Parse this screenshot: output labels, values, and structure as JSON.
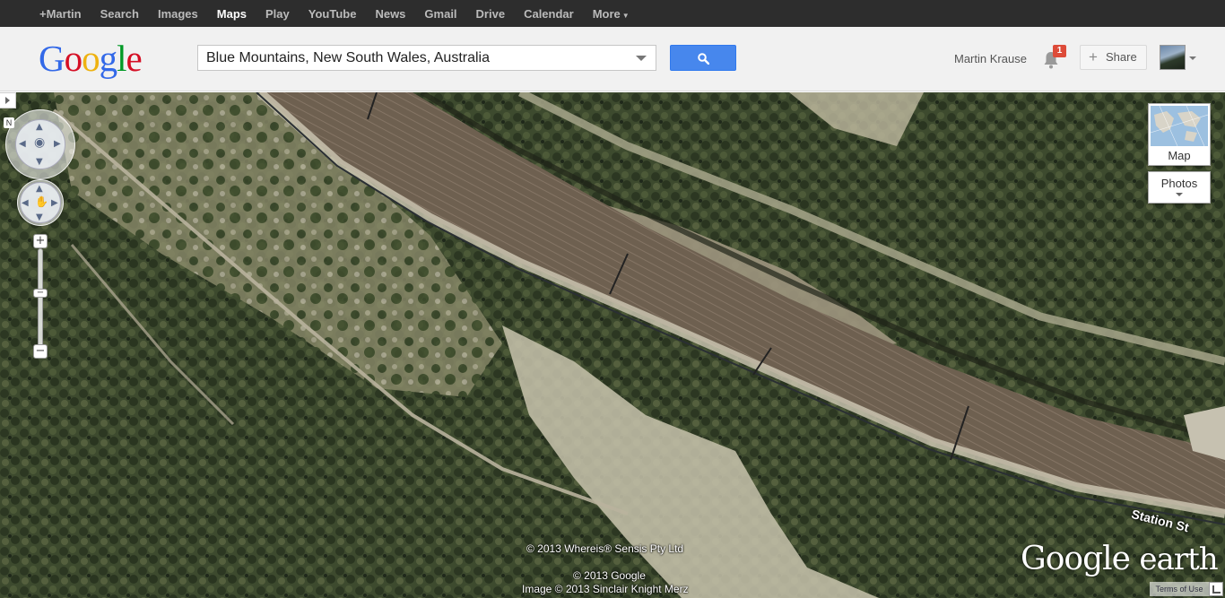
{
  "topbar": {
    "items": [
      "+Martin",
      "Search",
      "Images",
      "Maps",
      "Play",
      "YouTube",
      "News",
      "Gmail",
      "Drive",
      "Calendar",
      "More"
    ],
    "active": "Maps"
  },
  "header": {
    "logo": [
      "G",
      "o",
      "o",
      "g",
      "l",
      "e"
    ],
    "search_value": "Blue Mountains, New South Wales, Australia",
    "user_name": "Martin Krause",
    "notification_count": "1",
    "share_label": "Share"
  },
  "map": {
    "map_type_label": "Map",
    "photos_label": "Photos",
    "street_label": "Station St",
    "copyright_1": "© 2013 Whereis® Sensis Pty Ltd",
    "copyright_2": "© 2013 Google",
    "copyright_3": "Image © 2013 Sinclair Knight Merz",
    "earth_logo_google": "Google",
    "earth_logo_earth": "earth",
    "terms_label": "Terms of Use",
    "zoom_in": "+",
    "zoom_out": "−"
  },
  "colors": {
    "topbar_bg": "#2d2d2d",
    "header_bg": "#f1f1f1",
    "search_button": "#4787ed",
    "badge": "#dd4b39"
  }
}
